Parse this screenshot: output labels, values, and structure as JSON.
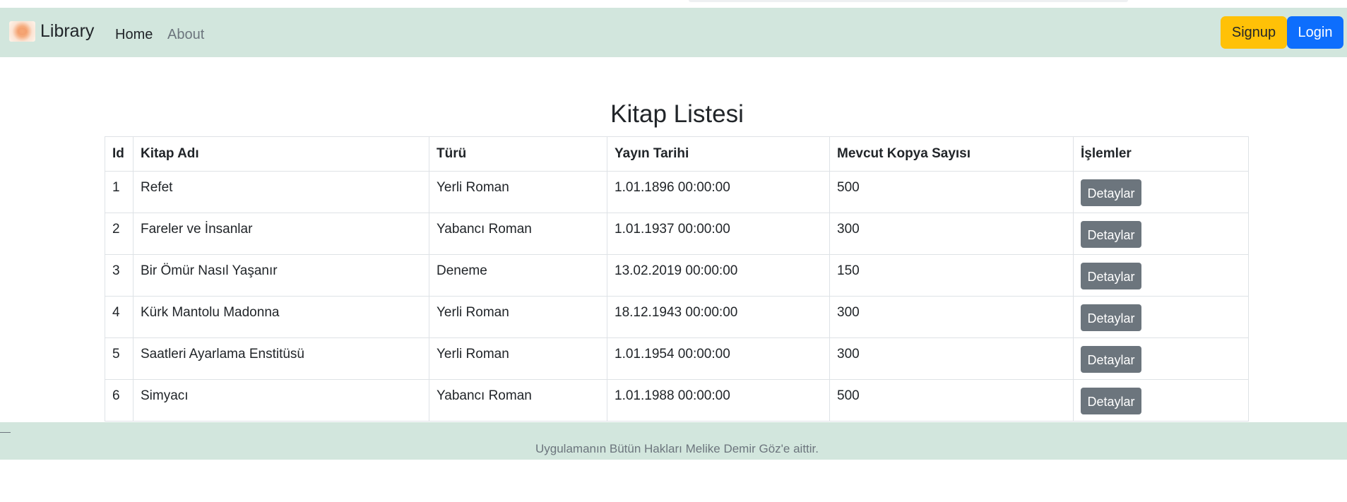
{
  "navbar": {
    "brand": "Library",
    "links": [
      {
        "label": "Home"
      },
      {
        "label": "About"
      }
    ],
    "signup_label": "Signup",
    "login_label": "Login"
  },
  "main": {
    "title": "Kitap Listesi",
    "table": {
      "headers": [
        "Id",
        "Kitap Adı",
        "Türü",
        "Yayın Tarihi",
        "Mevcut Kopya Sayısı",
        "İşlemler"
      ],
      "rows": [
        {
          "id": "1",
          "name": "Refet",
          "type": "Yerli Roman",
          "date": "1.01.1896 00:00:00",
          "copies": "500",
          "action": "Detaylar"
        },
        {
          "id": "2",
          "name": "Fareler ve İnsanlar",
          "type": "Yabancı Roman",
          "date": "1.01.1937 00:00:00",
          "copies": "300",
          "action": "Detaylar"
        },
        {
          "id": "3",
          "name": "Bir Ömür Nasıl Yaşanır",
          "type": "Deneme",
          "date": "13.02.2019 00:00:00",
          "copies": "150",
          "action": "Detaylar"
        },
        {
          "id": "4",
          "name": "Kürk Mantolu Madonna",
          "type": "Yerli Roman",
          "date": "18.12.1943 00:00:00",
          "copies": "300",
          "action": "Detaylar"
        },
        {
          "id": "5",
          "name": "Saatleri Ayarlama Enstitüsü",
          "type": "Yerli Roman",
          "date": "1.01.1954 00:00:00",
          "copies": "300",
          "action": "Detaylar"
        },
        {
          "id": "6",
          "name": "Simyacı",
          "type": "Yabancı Roman",
          "date": "1.01.1988 00:00:00",
          "copies": "500",
          "action": "Detaylar"
        }
      ]
    }
  },
  "footer": {
    "text": "Uygulamanın Bütün Hakları Melike Demir Göz'e aittir."
  },
  "colors": {
    "navbar_bg": "#d2e6dd",
    "signup_bg": "#ffc107",
    "login_bg": "#0d6efd",
    "details_bg": "#6c757d"
  }
}
